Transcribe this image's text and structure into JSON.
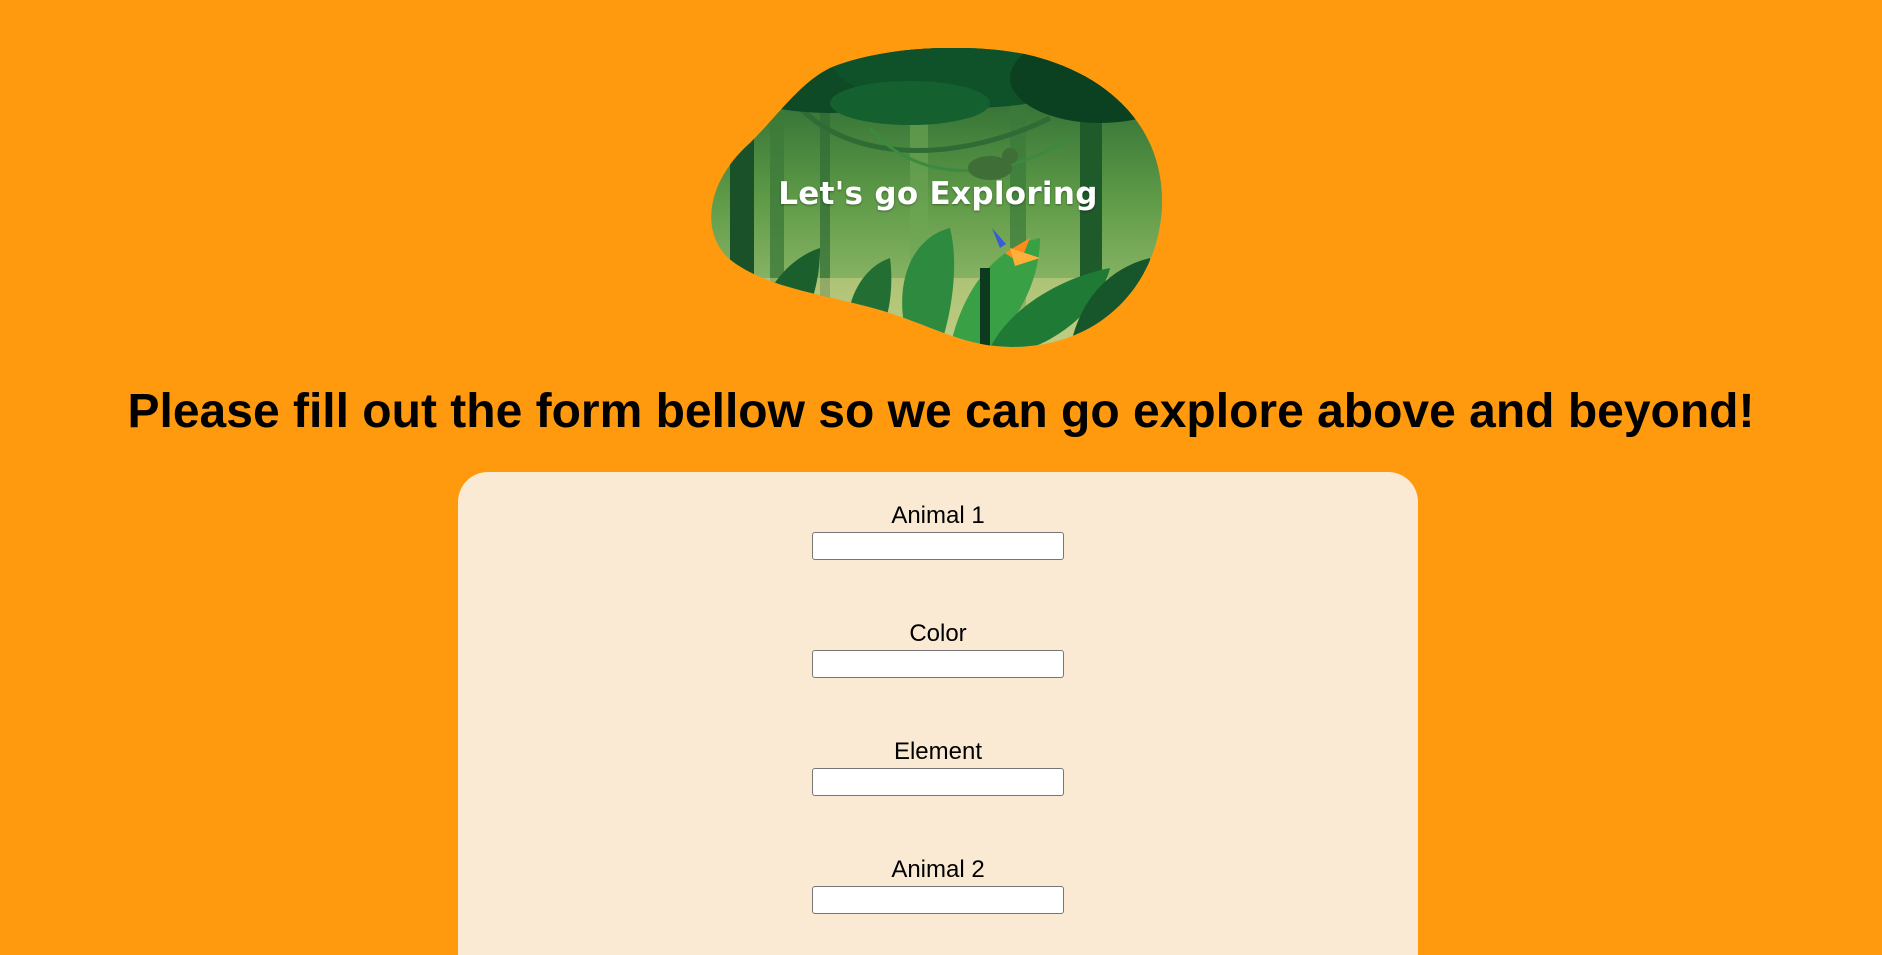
{
  "hero": {
    "title": "Let's go Exploring"
  },
  "headline": "Please fill out the form bellow so we can go explore above and beyond!",
  "form": {
    "fields": [
      {
        "label": "Animal 1",
        "value": "",
        "placeholder": ""
      },
      {
        "label": "Color",
        "value": "",
        "placeholder": ""
      },
      {
        "label": "Element",
        "value": "",
        "placeholder": ""
      },
      {
        "label": "Animal 2",
        "value": "",
        "placeholder": ""
      }
    ]
  },
  "colors": {
    "background": "#ff9a0e",
    "card": "#faead4",
    "jungle_dark": "#0e4a26",
    "jungle_mid": "#2f7d3a",
    "jungle_light": "#7fb85a"
  }
}
